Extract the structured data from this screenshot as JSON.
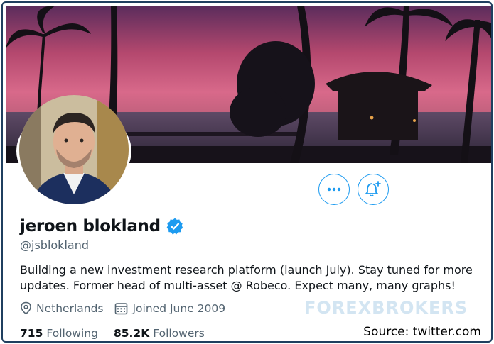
{
  "profile": {
    "display_name": "jeroen blokland",
    "handle": "@jsblokland",
    "bio": "Building a new investment research platform (launch July). Stay tuned for more updates. Former head of multi-asset @ Robeco. Expect many, many graphs!",
    "location": "Netherlands",
    "joined": "Joined June 2009",
    "following_count": "715",
    "following_label": "Following",
    "followers_count": "85.2K",
    "followers_label": "Followers",
    "verified": true
  },
  "actions": {
    "more_icon": "more-dots-icon",
    "notify_icon": "bell-plus-icon"
  },
  "watermark": "FOREXBROKERS",
  "caption": "Source: twitter.com",
  "colors": {
    "accent": "#1d9bf0",
    "text_primary": "#0f1419",
    "text_secondary": "#536471"
  }
}
